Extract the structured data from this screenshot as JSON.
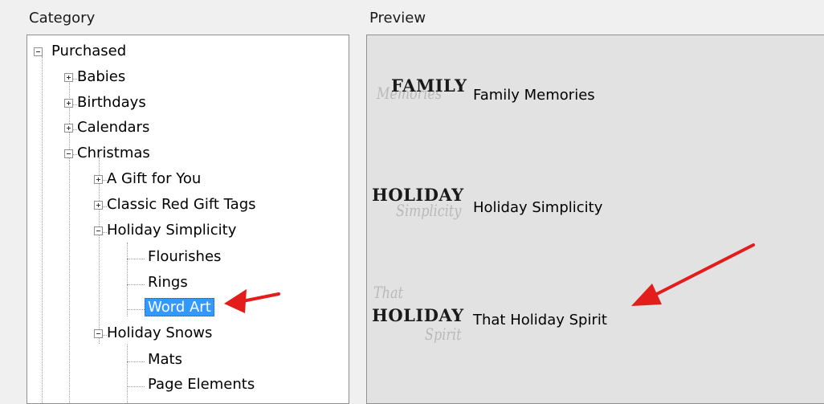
{
  "labels": {
    "category": "Category",
    "preview": "Preview"
  },
  "tree": {
    "purchased": "Purchased",
    "babies": "Babies",
    "birthdays": "Birthdays",
    "calendars": "Calendars",
    "christmas": "Christmas",
    "gift_for_you": "A Gift for You",
    "classic_red": "Classic Red Gift Tags",
    "holiday_simplicity": "Holiday Simplicity",
    "flourishes": "Flourishes",
    "rings": "Rings",
    "word_art": "Word Art",
    "holiday_snows": "Holiday Snows",
    "mats": "Mats",
    "page_elements": "Page Elements"
  },
  "preview": {
    "items": [
      {
        "name": "Family Memories",
        "thumb_main": "FAMILY",
        "thumb_script": "Memories"
      },
      {
        "name": "Holiday Simplicity",
        "thumb_main": "HOLIDAY",
        "thumb_script": "Simplicity"
      },
      {
        "name": "That Holiday Spirit",
        "thumb_main": "HOLIDAY",
        "thumb_script_top": "That",
        "thumb_script": "Spirit"
      }
    ]
  },
  "colors": {
    "selection": "#3399ff",
    "arrow": "#e31c1c"
  }
}
